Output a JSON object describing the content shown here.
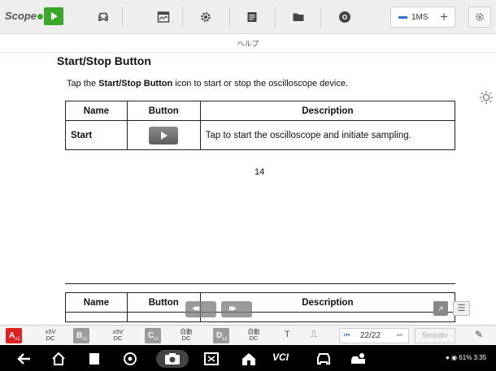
{
  "app": {
    "logo": "Scope",
    "subtitle": "ヘルプ"
  },
  "toolbar": {
    "timebase": {
      "value": "1MS"
    }
  },
  "help": {
    "title": "Start/Stop Button",
    "para_prefix": "Tap the ",
    "para_bold": "Start/Stop Button",
    "para_suffix": " icon to start or stop the oscilloscope device.",
    "table": {
      "headers": [
        "Name",
        "Button",
        "Description"
      ],
      "row": {
        "name": "Start",
        "description": "Tap to start the oscilloscope and initiate sampling."
      }
    },
    "page_number": "14",
    "table2_headers": [
      "Name",
      "Button",
      "Description"
    ]
  },
  "channels": [
    {
      "letter": "A",
      "sub": "x1",
      "range": "±5V",
      "coupling": "DC",
      "color": "#e02020"
    },
    {
      "letter": "B",
      "sub": "x1",
      "range": "±5V",
      "coupling": "DC"
    },
    {
      "letter": "C",
      "sub": "x1",
      "range": "自動",
      "coupling": "DC"
    },
    {
      "letter": "D",
      "sub": "x1",
      "range": "自動",
      "coupling": "DC"
    }
  ],
  "bottom": {
    "trigger_t": "T",
    "page": "22/22",
    "time_div": "5ms/div"
  },
  "navbar": {
    "vci": "VCI",
    "status": "61%  3:35"
  },
  "colors": {
    "accent_green": "#3aa92b",
    "channel_a": "#e02020",
    "accent_blue": "#2e6fd9"
  }
}
